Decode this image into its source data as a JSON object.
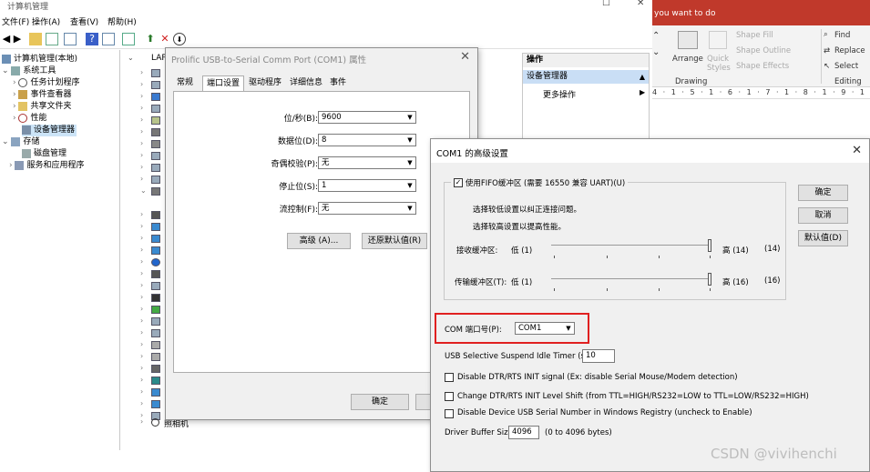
{
  "mmc": {
    "title": "计算机管理",
    "menu": [
      "文件(F)",
      "操作(A)",
      "查看(V)",
      "帮助(H)"
    ],
    "tree": [
      {
        "label": "计算机管理(本地)",
        "level": 0
      },
      {
        "label": "系统工具",
        "level": 1
      },
      {
        "label": "任务计划程序",
        "level": 2
      },
      {
        "label": "事件查看器",
        "level": 2
      },
      {
        "label": "共享文件夹",
        "level": 2
      },
      {
        "label": "性能",
        "level": 2
      },
      {
        "label": "设备管理器",
        "level": 2,
        "selected": true
      },
      {
        "label": "存储",
        "level": 0
      },
      {
        "label": "磁盘管理",
        "level": 2
      },
      {
        "label": "服务和应用程序",
        "level": 1
      }
    ],
    "device_header": "LAP",
    "camera_label": "照相机"
  },
  "actions": {
    "header": "操作",
    "selected": "设备管理器",
    "more": "更多操作"
  },
  "word": {
    "banner": "you want to do",
    "arrange": "Arrange",
    "quick_styles": "Quick\nStyles",
    "shape_fill": "Shape Fill",
    "shape_outline": "Shape Outline",
    "shape_effects": "Shape Effects",
    "drawing": "Drawing",
    "find": "Find",
    "replace": "Replace",
    "select": "Select",
    "editing": "Editing",
    "ruler": "4 · 1 · 5 · 1 · 6 · 1 · 7 · 1 · 8 · 1 · 9 · 1 · 10 · 1 · 11 · 1 · 12 · 1 · 13 · 1 · 14"
  },
  "props": {
    "title": "Prolific USB-to-Serial Comm Port (COM1) 属性",
    "tabs": [
      "常规",
      "端口设置",
      "驱动程序",
      "详细信息",
      "事件"
    ],
    "active_tab": "端口设置",
    "fields": [
      {
        "label": "位/秒(B):",
        "value": "9600"
      },
      {
        "label": "数据位(D):",
        "value": "8"
      },
      {
        "label": "奇偶校验(P):",
        "value": "无"
      },
      {
        "label": "停止位(S):",
        "value": "1"
      },
      {
        "label": "流控制(F):",
        "value": "无"
      }
    ],
    "advanced_button": "高级 (A)...",
    "restore_button": "还原默认值(R)",
    "ok_button": "确定"
  },
  "adv": {
    "title": "COM1 的高级设置",
    "fifo_label": "使用FIFO缓冲区 (需要 16550 兼容 UART)(U)",
    "fifo_checked": true,
    "hint_low": "选择较低设置以纠正连接问题。",
    "hint_high": "选择较高设置以提高性能。",
    "rx": {
      "label": "接收缓冲区:",
      "low": "低 (1)",
      "high": "高 (14)",
      "value": "(14)"
    },
    "tx": {
      "label": "传输缓冲区(T):",
      "low": "低 (1)",
      "high": "高 (16)",
      "value": "(16)"
    },
    "com_label": "COM 端口号(P):",
    "com_value": "COM1",
    "suspend_label": "USB Selective Suspend Idle Timer (secs):",
    "suspend_value": "10",
    "opt1": "Disable DTR/RTS INIT signal (Ex: disable Serial Mouse/Modem detection)",
    "opt2": "Change DTR/RTS INIT Level Shift (from TTL=HIGH/RS232=LOW to TTL=LOW/RS232=HIGH)",
    "opt3": "Disable Device USB Serial Number in Windows Registry (uncheck to Enable)",
    "buffer_label": "Driver Buffer Size:",
    "buffer_value": "4096",
    "buffer_range": "(0 to 4096 bytes)",
    "ok": "确定",
    "cancel": "取消",
    "defaults": "默认值(D)",
    "highlight_color": "#e02020"
  },
  "watermark": "CSDN @vivihenchi"
}
